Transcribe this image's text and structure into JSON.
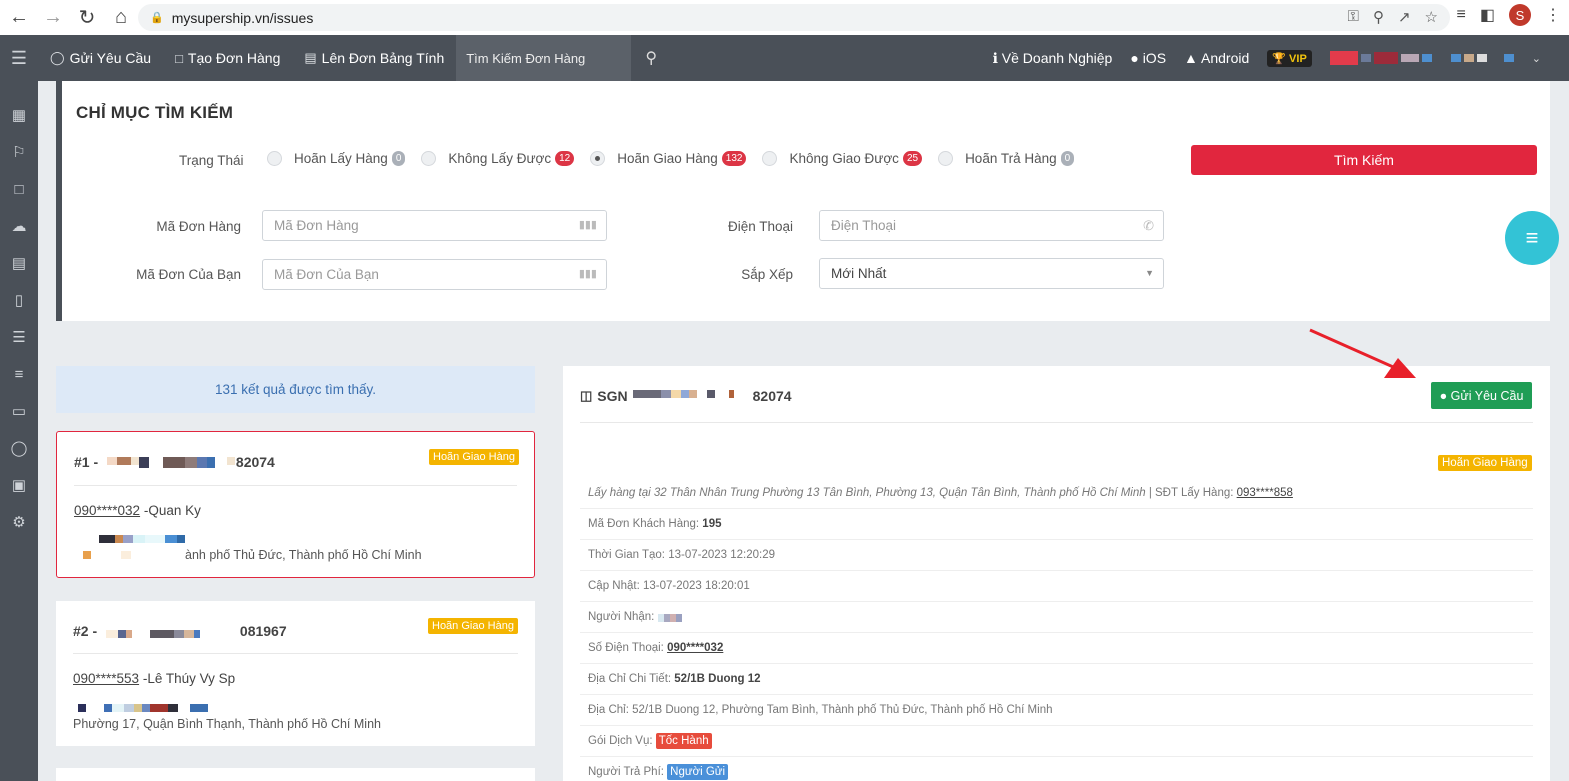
{
  "browser": {
    "url": "mysupership.vn/issues",
    "profile_initial": "S"
  },
  "header": {
    "nav": [
      {
        "icon": "chat-icon",
        "label": "Gửi Yêu Cầu"
      },
      {
        "icon": "scan-icon",
        "label": "Tạo Đơn Hàng"
      },
      {
        "icon": "spreadsheet-icon",
        "label": "Lên Đơn Bảng Tính"
      }
    ],
    "search_placeholder": "Tìm Kiếm Đơn Hàng",
    "right": [
      {
        "icon": "info-icon",
        "label": "Về Doanh Nghiệp"
      },
      {
        "icon": "apple-icon",
        "label": "iOS"
      },
      {
        "icon": "android-icon",
        "label": "Android"
      }
    ],
    "vip_label": "VIP"
  },
  "search": {
    "title": "CHỈ MỤC TÌM KIẾM",
    "status_label": "Trạng Thái",
    "statuses": [
      {
        "label": "Hoãn Lấy Hàng",
        "count": "0",
        "style": "grey",
        "checked": false
      },
      {
        "label": "Không Lấy Được",
        "count": "12",
        "style": "red",
        "checked": false
      },
      {
        "label": "Hoãn Giao Hàng",
        "count": "132",
        "style": "red",
        "checked": true
      },
      {
        "label": "Không Giao Được",
        "count": "25",
        "style": "red",
        "checked": false
      },
      {
        "label": "Hoãn Trả Hàng",
        "count": "0",
        "style": "grey",
        "checked": false
      }
    ],
    "search_button": "Tìm Kiếm",
    "order_code_label": "Mã Đơn Hàng",
    "order_code_placeholder": "Mã Đơn Hàng",
    "phone_label": "Điện Thoại",
    "phone_placeholder": "Điện Thoại",
    "your_code_label": "Mã Đơn Của Bạn",
    "your_code_placeholder": "Mã Đơn Của Bạn",
    "sort_label": "Sắp Xếp",
    "sort_value": "Mới Nhất"
  },
  "results": {
    "count_text": "131 kết quả được tìm thấy.",
    "cards": [
      {
        "prefix": "#1 -",
        "suffix": "82074",
        "badge": "Hoãn Giao Hàng",
        "phone": "090****032",
        "name": " -Quan Ky",
        "address": "ành phố Thủ Đức, Thành phố Hồ Chí Minh"
      },
      {
        "prefix": "#2 -",
        "suffix": "081967",
        "badge": "Hoãn Giao Hàng",
        "phone": "090****553",
        "name": " -Lê Thúy Vy Sp",
        "address": "Phường 17, Quận Bình Thạnh, Thành phố Hồ Chí Minh"
      }
    ]
  },
  "detail": {
    "code_prefix": "SGN",
    "code_suffix": "82074",
    "send_button": "Gửi Yêu Cầu",
    "badge": "Hoãn Giao Hàng",
    "pickup_text": "Lấy hàng tại 32 Thân Nhân Trung Phường 13 Tân Bình, Phường 13, Quận Tân Bình, Thành phố Hồ Chí Minh",
    "pickup_sep": " | ",
    "pickup_phone_label": "SĐT Lấy Hàng: ",
    "pickup_phone": "093****858",
    "customer_code_label": "Mã Đơn Khách Hàng: ",
    "customer_code": "195",
    "created_label": "Thời Gian Tạo: ",
    "created": "13-07-2023 12:20:29",
    "updated_label": "Cập Nhật: ",
    "updated": "13-07-2023 18:20:01",
    "receiver_label": "Người Nhận: ",
    "phone_label": "Số Điện Thoại: ",
    "phone": "090****032",
    "address_detail_label": "Địa Chỉ Chi Tiết: ",
    "address_detail": "52/1B Duong 12",
    "address_label": "Địa Chỉ: ",
    "address": "52/1B Duong 12, Phường Tam Bình, Thành phố Thủ Đức, Thành phố Hồ Chí Minh",
    "service_label": "Gói Dịch Vụ: ",
    "service": "Tốc Hành",
    "payer_label": "Người Trả Phí: ",
    "payer": "Người Gửi"
  },
  "colors": {
    "header_bg": "#4a5058",
    "search_red": "#e1263e",
    "send_green": "#1f9d55",
    "badge_yellow": "#f4b400",
    "fab_cyan": "#33c3d6",
    "arrow_red": "#e8202a"
  }
}
